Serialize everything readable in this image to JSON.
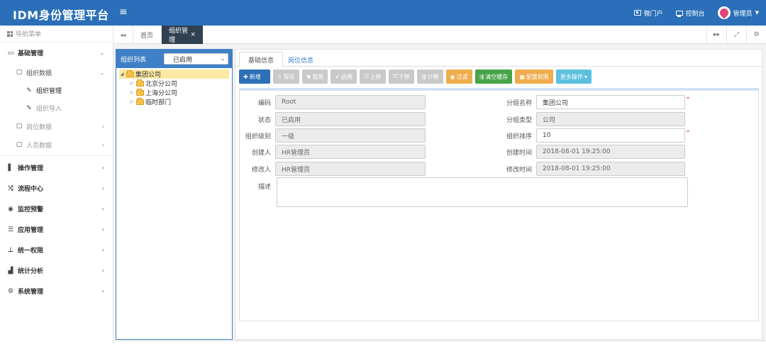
{
  "app": {
    "title": "IDM身份管理平台",
    "menu_toggle": "≡",
    "portal_label": "微门户",
    "console_label": "控制台",
    "user_label": "管理员",
    "user_caret": "▼"
  },
  "sidebar": {
    "header": "导航菜单",
    "items": [
      {
        "label": "基础管理",
        "icon": "▭",
        "chevron": "⌄"
      },
      {
        "label": "组织数据",
        "icon": "▢",
        "chevron": "⌄"
      },
      {
        "label": "组织管理",
        "icon": "✎"
      },
      {
        "label": "组织导入",
        "icon": "✎"
      },
      {
        "label": "岗位数据",
        "icon": "▢",
        "chevron": "‹"
      },
      {
        "label": "人员数据",
        "icon": "▢",
        "chevron": "‹"
      },
      {
        "label": "操作管理",
        "icon": "▌",
        "chevron": "‹"
      },
      {
        "label": "流程中心",
        "icon": "⤭",
        "chevron": "‹"
      },
      {
        "label": "监控预警",
        "icon": "◉",
        "chevron": "‹"
      },
      {
        "label": "应用管理",
        "icon": "☰",
        "chevron": "‹"
      },
      {
        "label": "统一权限",
        "icon": "⊥",
        "chevron": "‹"
      },
      {
        "label": "统计分析",
        "icon": "▟",
        "chevron": "‹"
      },
      {
        "label": "系统管理",
        "icon": "⚙",
        "chevron": "‹"
      }
    ]
  },
  "tabs": {
    "nav_left": "◂◂",
    "home": "首页",
    "active": "组织管理",
    "close": "×",
    "nav_right": "▸▸",
    "fullscreen": "⤢",
    "settings": "⚙"
  },
  "tree": {
    "header": "组织列表",
    "filter_value": "已启用",
    "filter_arrow": "⌄",
    "nodes": [
      {
        "label": "集团公司",
        "toggle": "◢"
      },
      {
        "label": "北京分公司",
        "toggle": "▷"
      },
      {
        "label": "上海分公司",
        "toggle": "▷"
      },
      {
        "label": "临时部门",
        "toggle": "▷"
      }
    ]
  },
  "main": {
    "tab_basic": "基础信息",
    "tab_post": "岗位信息",
    "toolbar": {
      "add": {
        "icon": "✚",
        "label": "新增"
      },
      "save": {
        "icon": "⇩",
        "label": "保存"
      },
      "delete": {
        "icon": "✖",
        "label": "禁用"
      },
      "enable": {
        "icon": "✔",
        "label": "启用"
      },
      "move_up": {
        "icon": "⤭",
        "label": "上移"
      },
      "move_down": {
        "icon": "⤭",
        "label": "下移"
      },
      "sync": {
        "icon": "⇶",
        "label": "计移"
      },
      "filter": {
        "icon": "◉",
        "label": "过滤"
      },
      "clear_cache": {
        "icon": "⇶",
        "label": "清空缓存"
      },
      "config": {
        "icon": "▦",
        "label": "配置权限"
      },
      "more": {
        "label": "更多操作",
        "caret": "▾"
      }
    },
    "form": {
      "code": {
        "label": "编码",
        "value": "Root"
      },
      "status": {
        "label": "状态",
        "value": "已启用"
      },
      "level": {
        "label": "组织级别",
        "value": "一级"
      },
      "creator": {
        "label": "创建人",
        "value": "HR管理员"
      },
      "modifier": {
        "label": "修改人",
        "value": "HR管理员"
      },
      "group_name": {
        "label": "分组名称",
        "value": "集团公司"
      },
      "group_type": {
        "label": "分组类型",
        "value": "公司"
      },
      "order": {
        "label": "组织排序",
        "value": "10"
      },
      "create_time": {
        "label": "创建时间",
        "value": "2018-08-01 19:25:00"
      },
      "modify_time": {
        "label": "修改时间",
        "value": "2018-08-01 19:25:00"
      },
      "description": {
        "label": "描述",
        "value": ""
      },
      "required_mark": "*"
    }
  }
}
